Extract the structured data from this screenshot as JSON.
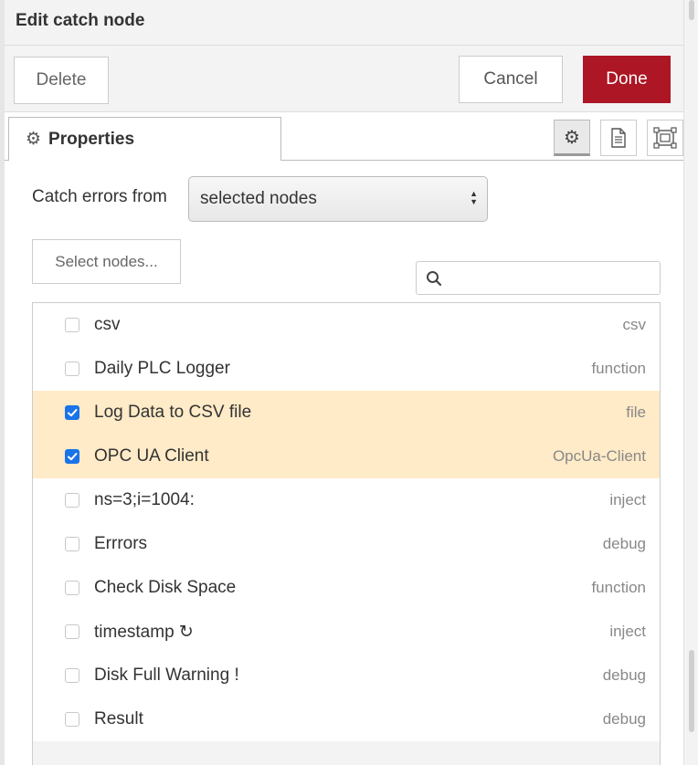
{
  "header": {
    "title": "Edit catch node"
  },
  "toolbar": {
    "delete_label": "Delete",
    "cancel_label": "Cancel",
    "done_label": "Done",
    "done_color": "#ad1625"
  },
  "tabs": {
    "properties_label": "Properties",
    "icons": [
      "gear-icon",
      "description-icon",
      "appearance-icon"
    ]
  },
  "form": {
    "catch_label": "Catch errors from",
    "catch_value": "selected nodes",
    "select_nodes_label": "Select nodes...",
    "search_placeholder": ""
  },
  "nodes": [
    {
      "name": "csv",
      "type": "csv",
      "checked": false
    },
    {
      "name": "Daily PLC Logger",
      "type": "function",
      "checked": false
    },
    {
      "name": "Log Data to CSV file",
      "type": "file",
      "checked": true
    },
    {
      "name": "OPC UA Client",
      "type": "OpcUa-Client",
      "checked": true
    },
    {
      "name": "ns=3;i=1004:",
      "type": "inject",
      "checked": false
    },
    {
      "name": "Errrors",
      "type": "debug",
      "checked": false
    },
    {
      "name": "Check Disk Space",
      "type": "function",
      "checked": false
    },
    {
      "name": "timestamp ↻",
      "type": "inject",
      "checked": false
    },
    {
      "name": "Disk Full Warning !",
      "type": "debug",
      "checked": false
    },
    {
      "name": "Result",
      "type": "debug",
      "checked": false
    }
  ],
  "colors": {
    "selected_row": "#ffebc7",
    "checkbox": "#1a73e8"
  }
}
